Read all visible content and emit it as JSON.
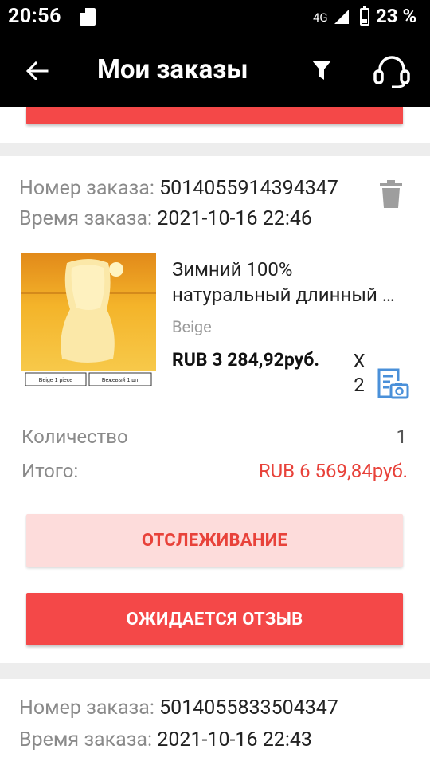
{
  "status_bar": {
    "time": "20:56",
    "network": "4G",
    "battery": "23 %",
    "icons": [
      "sd-card-icon",
      "signal-icon",
      "battery-icon"
    ]
  },
  "header": {
    "title": "Мои заказы",
    "icons": [
      "back-arrow-icon",
      "filter-icon",
      "headset-icon"
    ]
  },
  "orders": [
    {
      "number_label": "Номер заказа:",
      "number": "5014055914394347",
      "time_label": "Время заказа:",
      "time": "2021-10-16 22:46",
      "product": {
        "name_line1": "Зимний 100%",
        "name_line2": "натуральный длинный мех овчины",
        "variant": "Beige",
        "price": "RUB 3 284,92руб.",
        "qty_x": "X",
        "qty_n": "2",
        "image_labels": [
          "Beige  1 piece",
          "Бежевый 1 шт"
        ]
      },
      "quantity_label": "Количество",
      "quantity": "1",
      "total_label": "Итого:",
      "total": "RUB 6 569,84руб.",
      "track_button": "ОТСЛЕЖИВАНИЕ",
      "review_button": "ОЖИДАЕТСЯ ОТЗЫВ"
    },
    {
      "number_label": "Номер заказа:",
      "number": "5014055833504347",
      "time_label": "Время заказа:",
      "time": "2021-10-16 22:43"
    }
  ],
  "colors": {
    "accent": "#f44848",
    "accent_light": "#fddcdb",
    "total_red": "#e8423a",
    "icon_blue": "#4a90d9"
  }
}
